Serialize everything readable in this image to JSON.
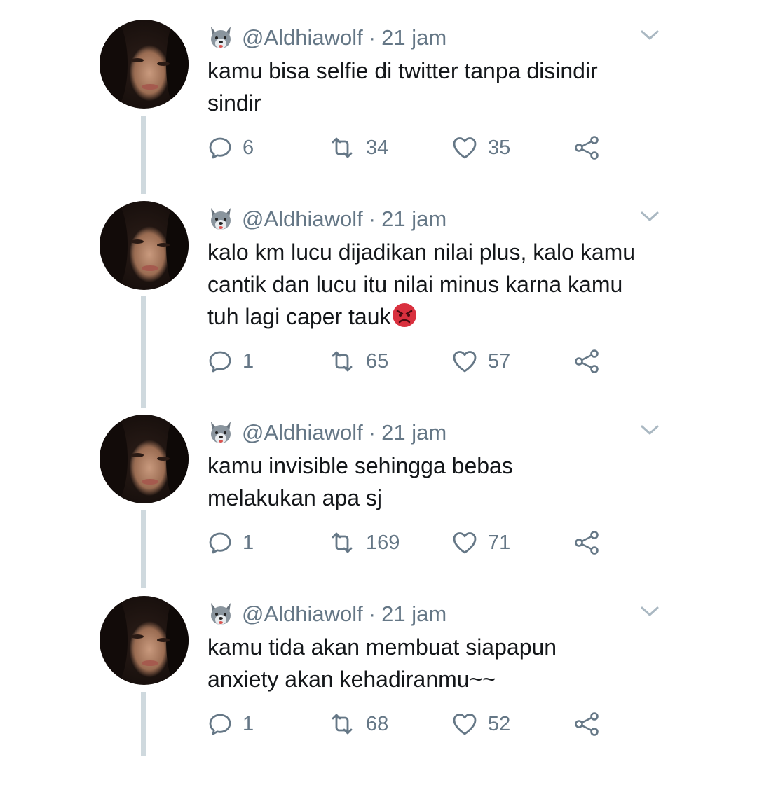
{
  "colors": {
    "text": "#14171a",
    "muted": "#657786",
    "thread": "#cfd9de",
    "angry_face": "#d9303e"
  },
  "tweets": [
    {
      "handle": "@Aldhiawolf",
      "separator": "·",
      "time": "21 jam",
      "text": "kamu bisa selfie di twitter tanpa disindir sindir",
      "emoji_after_text": "",
      "replies": "6",
      "retweets": "34",
      "likes": "35"
    },
    {
      "handle": "@Aldhiawolf",
      "separator": "·",
      "time": "21 jam",
      "text": "kalo km lucu dijadikan nilai plus, kalo kamu cantik dan lucu itu nilai minus karna kamu tuh lagi caper tauk",
      "emoji_after_text": "angry-face",
      "replies": "1",
      "retweets": "65",
      "likes": "57"
    },
    {
      "handle": "@Aldhiawolf",
      "separator": "·",
      "time": "21 jam",
      "text": "kamu invisible sehingga bebas melakukan apa sj",
      "emoji_after_text": "",
      "replies": "1",
      "retweets": "169",
      "likes": "71"
    },
    {
      "handle": "@Aldhiawolf",
      "separator": "·",
      "time": "21 jam",
      "text": "kamu tida akan membuat siapapun anxiety akan kehadiranmu~~",
      "emoji_after_text": "",
      "replies": "1",
      "retweets": "68",
      "likes": "52"
    }
  ],
  "icons": {
    "handle_emoji": "wolf-face-icon",
    "menu": "chevron-down-icon",
    "reply": "reply-icon",
    "retweet": "retweet-icon",
    "like": "heart-icon",
    "share": "share-icon"
  }
}
